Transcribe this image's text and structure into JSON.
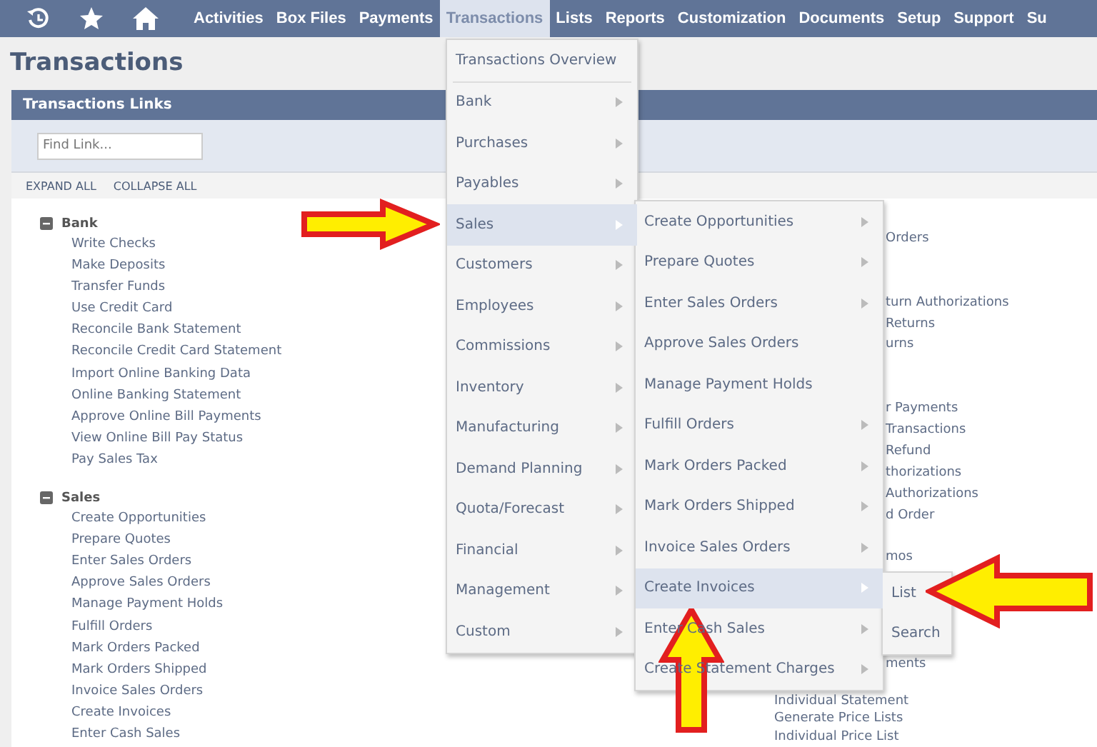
{
  "nav": {
    "items": [
      {
        "label": "Activities",
        "selected": false
      },
      {
        "label": "Box Files",
        "selected": false
      },
      {
        "label": "Payments",
        "selected": false
      },
      {
        "label": "Transactions",
        "selected": true
      },
      {
        "label": "Lists",
        "selected": false
      },
      {
        "label": "Reports",
        "selected": false
      },
      {
        "label": "Customization",
        "selected": false
      },
      {
        "label": "Documents",
        "selected": false
      },
      {
        "label": "Setup",
        "selected": false
      },
      {
        "label": "Support",
        "selected": false
      },
      {
        "label": "Su",
        "selected": false
      }
    ]
  },
  "page_title": "Transactions",
  "panel": {
    "title": "Transactions Links",
    "search": {
      "placeholder": "Find Link..."
    },
    "actions": [
      "EXPAND ALL",
      "COLLAPSE ALL"
    ],
    "sections": [
      {
        "title": "Bank",
        "expanded": true,
        "links": [
          "Write Checks",
          "Make Deposits",
          "Transfer Funds",
          "Use Credit Card",
          "Reconcile Bank Statement",
          "Reconcile Credit Card Statement",
          "Import Online Banking Data",
          "Online Banking Statement",
          "Approve Online Bill Payments",
          "View Online Bill Pay Status",
          "Pay Sales Tax"
        ]
      },
      {
        "title": "Sales",
        "expanded": true,
        "links": [
          "Create Opportunities",
          "Prepare Quotes",
          "Enter Sales Orders",
          "Approve Sales Orders",
          "Manage Payment Holds",
          "Fulfill Orders",
          "Mark Orders Packed",
          "Mark Orders Shipped",
          "Invoice Sales Orders",
          "Create Invoices",
          "Enter Cash Sales"
        ]
      }
    ],
    "column_2": [
      {
        "text": "Orders",
        "kind": "fragment"
      },
      {
        "text": "turn Authorizations",
        "kind": "fragment"
      },
      {
        "text": "Returns",
        "kind": "fragment"
      },
      {
        "text": "urns",
        "kind": "fragment"
      },
      {
        "text": "r Payments",
        "kind": "fragment"
      },
      {
        "text": "Transactions",
        "kind": "fragment"
      },
      {
        "text": "Refund",
        "kind": "fragment"
      },
      {
        "text": "thorizations",
        "kind": "fragment"
      },
      {
        "text": "Authorizations",
        "kind": "fragment"
      },
      {
        "text": "d Order",
        "kind": "fragment"
      },
      {
        "text": "mos",
        "kind": "fragment"
      },
      {
        "text": "ments",
        "kind": "fragment"
      },
      {
        "text": "Individual Statement",
        "kind": "link"
      },
      {
        "text": "Generate Price Lists",
        "kind": "link"
      },
      {
        "text": "Individual Price List",
        "kind": "link"
      }
    ]
  },
  "menu": {
    "items": [
      {
        "label": "Transactions Overview",
        "submenu": false,
        "selected": false
      },
      {
        "label": "Bank",
        "submenu": true,
        "selected": false
      },
      {
        "label": "Purchases",
        "submenu": true,
        "selected": false
      },
      {
        "label": "Payables",
        "submenu": true,
        "selected": false
      },
      {
        "label": "Sales",
        "submenu": true,
        "selected": true
      },
      {
        "label": "Customers",
        "submenu": true,
        "selected": false
      },
      {
        "label": "Employees",
        "submenu": true,
        "selected": false
      },
      {
        "label": "Commissions",
        "submenu": true,
        "selected": false
      },
      {
        "label": "Inventory",
        "submenu": true,
        "selected": false
      },
      {
        "label": "Manufacturing",
        "submenu": true,
        "selected": false
      },
      {
        "label": "Demand Planning",
        "submenu": true,
        "selected": false
      },
      {
        "label": "Quota/Forecast",
        "submenu": true,
        "selected": false
      },
      {
        "label": "Financial",
        "submenu": true,
        "selected": false
      },
      {
        "label": "Management",
        "submenu": true,
        "selected": false
      },
      {
        "label": "Custom",
        "submenu": true,
        "selected": false
      }
    ]
  },
  "submenu": {
    "items": [
      {
        "label": "Create Opportunities",
        "submenu": true,
        "selected": false
      },
      {
        "label": "Prepare Quotes",
        "submenu": true,
        "selected": false
      },
      {
        "label": "Enter Sales Orders",
        "submenu": true,
        "selected": false
      },
      {
        "label": "Approve Sales Orders",
        "submenu": false,
        "selected": false
      },
      {
        "label": "Manage Payment Holds",
        "submenu": false,
        "selected": false
      },
      {
        "label": "Fulfill Orders",
        "submenu": true,
        "selected": false
      },
      {
        "label": "Mark Orders Packed",
        "submenu": true,
        "selected": false
      },
      {
        "label": "Mark Orders Shipped",
        "submenu": true,
        "selected": false
      },
      {
        "label": "Invoice Sales Orders",
        "submenu": true,
        "selected": false
      },
      {
        "label": "Create Invoices",
        "submenu": true,
        "selected": true
      },
      {
        "label": "Enter Cash Sales",
        "submenu": true,
        "selected": false
      },
      {
        "label": "Create Statement Charges",
        "submenu": true,
        "selected": false
      }
    ]
  },
  "flyout": {
    "items": [
      {
        "label": "List",
        "selected": false
      },
      {
        "label": "Search",
        "selected": false
      }
    ]
  }
}
